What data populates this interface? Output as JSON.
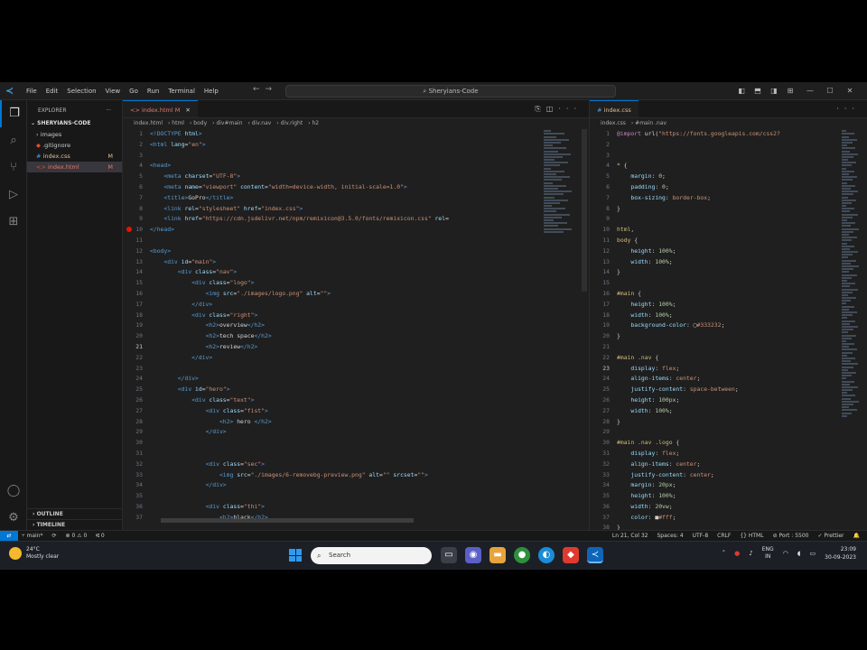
{
  "titlebar": {
    "menu": [
      "File",
      "Edit",
      "Selection",
      "View",
      "Go",
      "Run",
      "Terminal",
      "Help"
    ],
    "search": "Sheryians-Code"
  },
  "sidebar": {
    "header": "EXPLORER",
    "folder": "SHERYIANS-CODE",
    "items": [
      {
        "name": "images",
        "status": "",
        "prefix": "›"
      },
      {
        "name": ".gitignore",
        "status": "",
        "prefix": "◆"
      },
      {
        "name": "index.css",
        "status": "M",
        "prefix": "#"
      },
      {
        "name": "index.html",
        "status": "M",
        "prefix": "<>"
      }
    ],
    "outline": "OUTLINE",
    "timeline": "TIMELINE"
  },
  "editor1": {
    "tab": "index.html",
    "tab_status": "M",
    "breadcrumbs": [
      "index.html",
      "html",
      "body",
      "div#main",
      "div.nav",
      "div.right",
      "h2"
    ]
  },
  "editor2": {
    "tab": "index.css",
    "breadcrumbs": [
      "index.css",
      "#main .nav"
    ]
  },
  "statusbar": {
    "branch": "main*",
    "sync": "⟳",
    "problems": "⊗ 0 ⚠ 0",
    "ports": "⑆ 0",
    "position": "Ln 21, Col 32",
    "spaces": "Spaces: 4",
    "encoding": "UTF-8",
    "eol": "CRLF",
    "language": "{} HTML",
    "port": "⊘ Port : 5500",
    "prettier": "✓ Prettier"
  },
  "taskbar": {
    "temp": "24°C",
    "weather": "Mostly clear",
    "search": "Search",
    "lang1": "ENG",
    "lang2": "IN",
    "time": "23:09",
    "date": "30-09-2023"
  }
}
